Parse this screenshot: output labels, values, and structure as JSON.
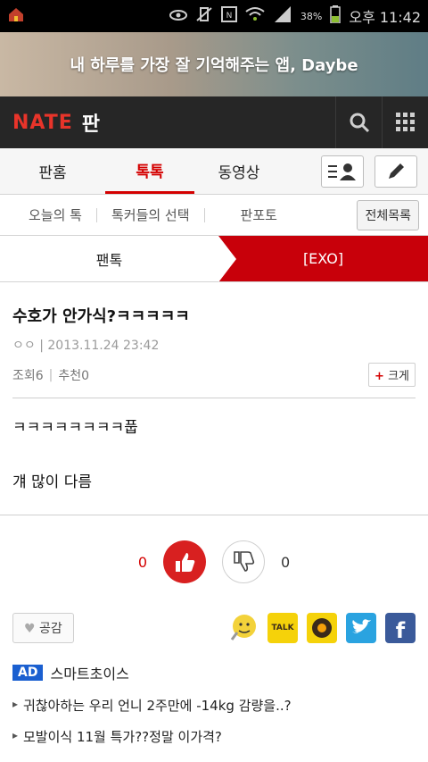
{
  "status_bar": {
    "battery": "38%",
    "time": "오후 11:42"
  },
  "banner": {
    "text": "내 하루를 가장 잘 기억해주는 앱, Daybe"
  },
  "app": {
    "logo": "NATE",
    "section": "판"
  },
  "main_tabs": [
    "판홈",
    "톡톡",
    "동영상"
  ],
  "sub_tabs": [
    "오늘의 톡",
    "톡커들의 선택",
    "판포토"
  ],
  "all_list_label": "전체목록",
  "crumbs": {
    "first": "팬톡",
    "second": "[EXO]"
  },
  "post": {
    "title": "수호가 안가식?ㅋㅋㅋㅋㅋ",
    "author": "ㅇㅇ",
    "date": "2013.11.24 23:42",
    "views": "조회6",
    "recommend": "추천0",
    "enlarge_label": "크게"
  },
  "body_lines": [
    "ㅋㅋㅋㅋㅋㅋㅋㅋ풉",
    "걔 많이 다름"
  ],
  "votes": {
    "up": "0",
    "down": "0"
  },
  "share": {
    "empathy_label": "공감",
    "kakao_label": "TALK"
  },
  "ad": {
    "tag": "AD",
    "brand": "스마트초이스",
    "items": [
      "귀찮아하는 우리 언니 2주만에 -14kg 감량을..?",
      "모발이식 11월 특가??정말 이가격?"
    ]
  }
}
